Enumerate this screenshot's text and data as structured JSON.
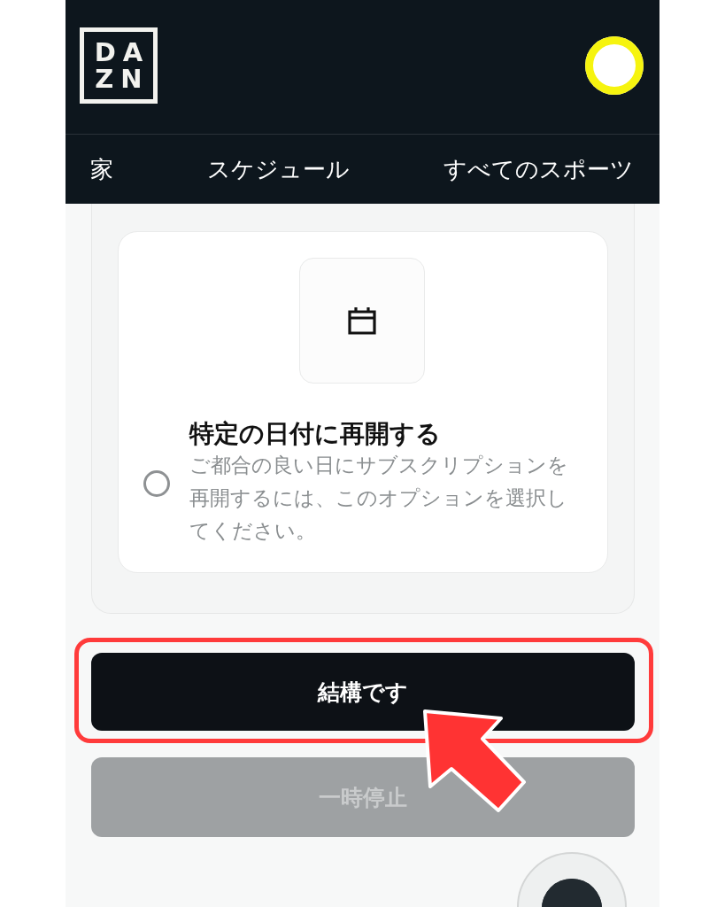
{
  "header": {
    "logo_lines": [
      "DA",
      "ZN"
    ],
    "avatar": true
  },
  "nav": [
    {
      "label": "家",
      "selected": false
    },
    {
      "label": "スケジュール",
      "selected": false
    },
    {
      "label": "すべてのスポーツ",
      "selected": false
    }
  ],
  "option": {
    "title": "特定の日付に再開する",
    "description": "ご都合の良い日にサブスクリプションを再開するには、このオプションを選択してください。",
    "selected": false
  },
  "buttons": [
    {
      "label": "結構です",
      "kind": "primary",
      "highlighted": true
    },
    {
      "label": "一時停止",
      "kind": "disabled",
      "highlighted": false
    }
  ],
  "chat_button": true
}
